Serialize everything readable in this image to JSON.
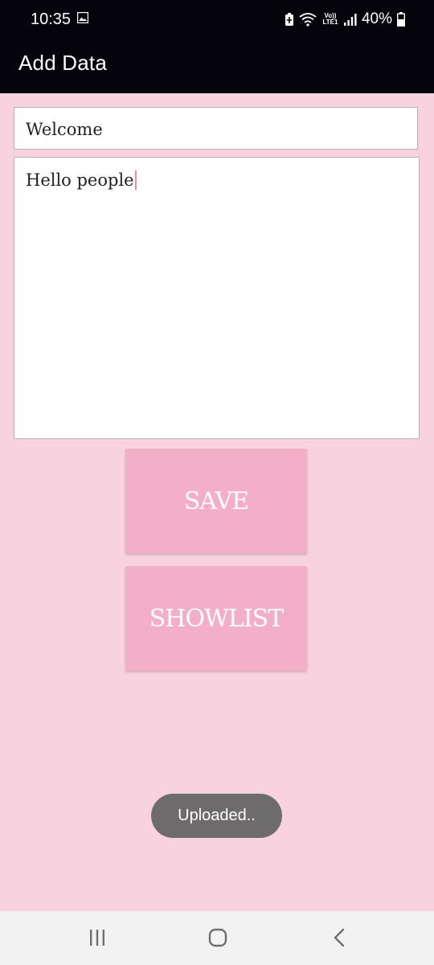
{
  "status_bar": {
    "time": "10:35",
    "gallery_icon": "image-icon",
    "battery_saver_icon": "battery-saver-icon",
    "wifi_icon": "wifi-icon",
    "volte_label": "Vo)) LTE1",
    "signal_icon": "signal-icon",
    "battery_percent": "40%",
    "battery_icon": "battery-icon"
  },
  "app_bar": {
    "title": "Add Data"
  },
  "form": {
    "title_value": "Welcome",
    "body_value": "Hello people"
  },
  "buttons": {
    "save_label": "SAVE",
    "showlist_label": "SHOWLIST"
  },
  "toast": {
    "message": "Uploaded.."
  },
  "nav_bar": {
    "recents_icon": "recents-icon",
    "home_icon": "home-icon",
    "back_icon": "back-icon"
  },
  "colors": {
    "background": "#f8d3df",
    "app_bar": "#05040a",
    "button": "#f4afc8",
    "toast": "#6d6b6c",
    "caret": "#e98ab0"
  }
}
